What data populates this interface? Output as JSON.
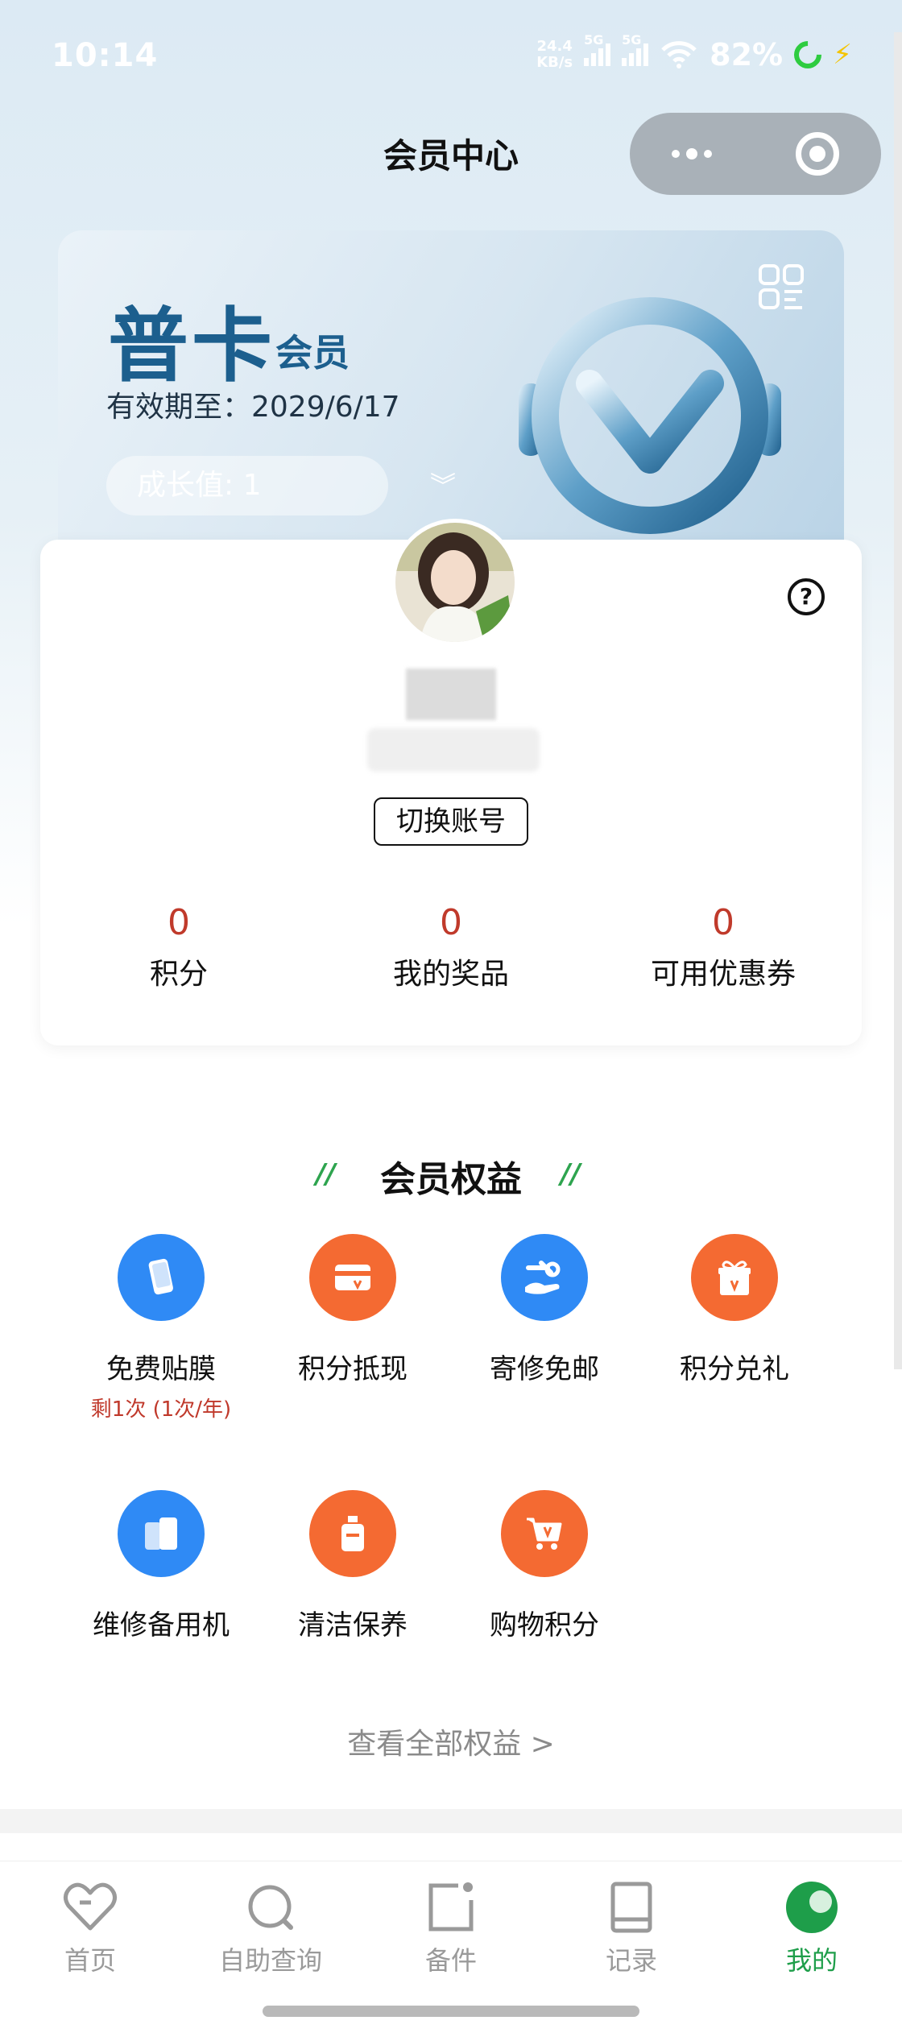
{
  "status": {
    "time": "10:14",
    "netspeed_value": "24.4",
    "netspeed_unit": "KB/s",
    "sim1": "5G",
    "sim2": "5G",
    "battery": "82%"
  },
  "header": {
    "title": "会员中心"
  },
  "card": {
    "tier": "普卡",
    "tier_suffix": "会员",
    "validity": "有效期至：2029/6/17",
    "growth": "成长值: 1"
  },
  "profile": {
    "switch_label": "切换账号",
    "stats": [
      {
        "value": "0",
        "label": "积分"
      },
      {
        "value": "0",
        "label": "我的奖品"
      },
      {
        "value": "0",
        "label": "可用优惠券"
      }
    ]
  },
  "benefits": {
    "title": "会员权益",
    "items": [
      {
        "label": "免费贴膜",
        "sub": "剩1次 (1次/年)",
        "icon": "phone-film-icon",
        "color": "#2f8af5"
      },
      {
        "label": "积分抵现",
        "icon": "card-v-icon",
        "color": "#f46a32"
      },
      {
        "label": "寄修免邮",
        "icon": "wrench-hand-icon",
        "color": "#2f8af5"
      },
      {
        "label": "积分兑礼",
        "icon": "gift-icon",
        "color": "#f46a32"
      },
      {
        "label": "维修备用机",
        "icon": "spare-phone-icon",
        "color": "#2f8af5"
      },
      {
        "label": "清洁保养",
        "icon": "cleaner-bottle-icon",
        "color": "#f46a32"
      },
      {
        "label": "购物积分",
        "icon": "cart-icon",
        "color": "#f46a32"
      }
    ],
    "view_all": "查看全部权益 >"
  },
  "tabs": [
    {
      "label": "首页",
      "icon": "heart-icon"
    },
    {
      "label": "自助查询",
      "icon": "search-icon"
    },
    {
      "label": "备件",
      "icon": "parts-icon"
    },
    {
      "label": "记录",
      "icon": "record-icon"
    },
    {
      "label": "我的",
      "icon": "my-icon",
      "active": true
    }
  ]
}
